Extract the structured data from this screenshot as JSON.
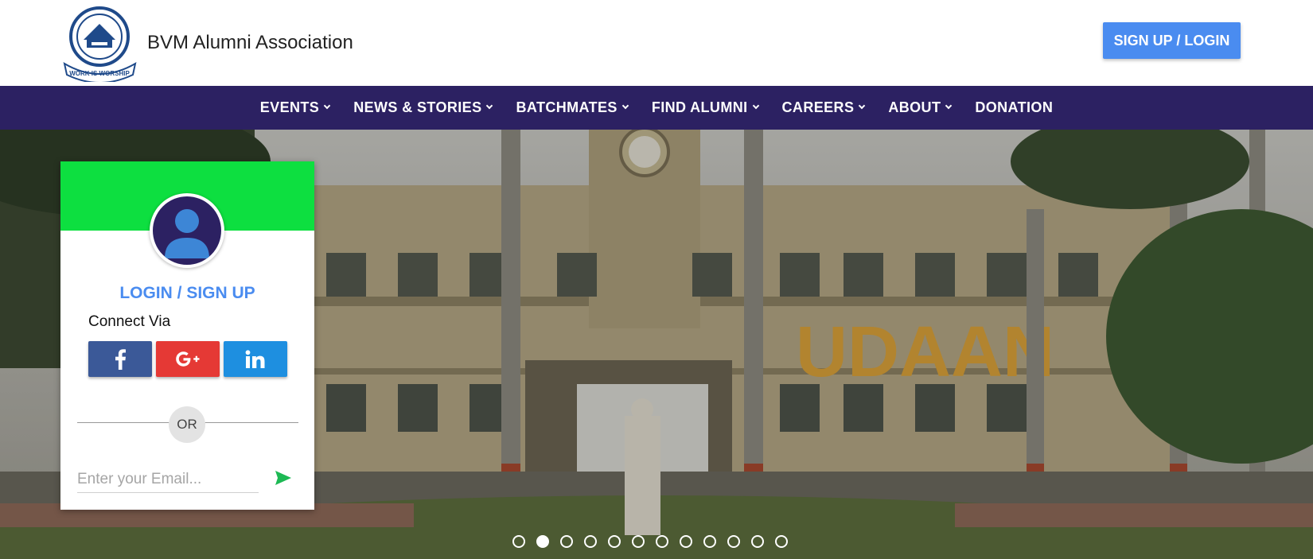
{
  "header": {
    "logo_icon": "bvm-emblem",
    "logo_motto": "WORK IS WORSHIP",
    "site_title": "BVM Alumni Association",
    "signup_label": "SIGN UP / LOGIN"
  },
  "nav": {
    "items": [
      {
        "label": "EVENTS",
        "dropdown": true
      },
      {
        "label": "NEWS & STORIES",
        "dropdown": true
      },
      {
        "label": "BATCHMATES",
        "dropdown": true
      },
      {
        "label": "FIND ALUMNI",
        "dropdown": true
      },
      {
        "label": "CAREERS",
        "dropdown": true
      },
      {
        "label": "ABOUT",
        "dropdown": true
      },
      {
        "label": "DONATION",
        "dropdown": false
      }
    ]
  },
  "hero": {
    "banner_text": "UDAAN",
    "carousel": {
      "total": 12,
      "active": 2
    }
  },
  "login_card": {
    "title": "LOGIN / SIGN UP",
    "connect_label": "Connect Via",
    "social": [
      {
        "name": "facebook",
        "icon": "facebook-icon",
        "color": "#3b5998"
      },
      {
        "name": "google-plus",
        "icon": "google-plus-icon",
        "color": "#e53935"
      },
      {
        "name": "linkedin",
        "icon": "linkedin-icon",
        "color": "#1e8fe0"
      }
    ],
    "or_label": "OR",
    "email_placeholder": "Enter your Email...",
    "send_icon": "send-icon"
  },
  "colors": {
    "nav_bg": "#2c2162",
    "accent_blue": "#4a8cf0",
    "card_header_green": "#0ddf40",
    "send_green": "#1db954"
  }
}
